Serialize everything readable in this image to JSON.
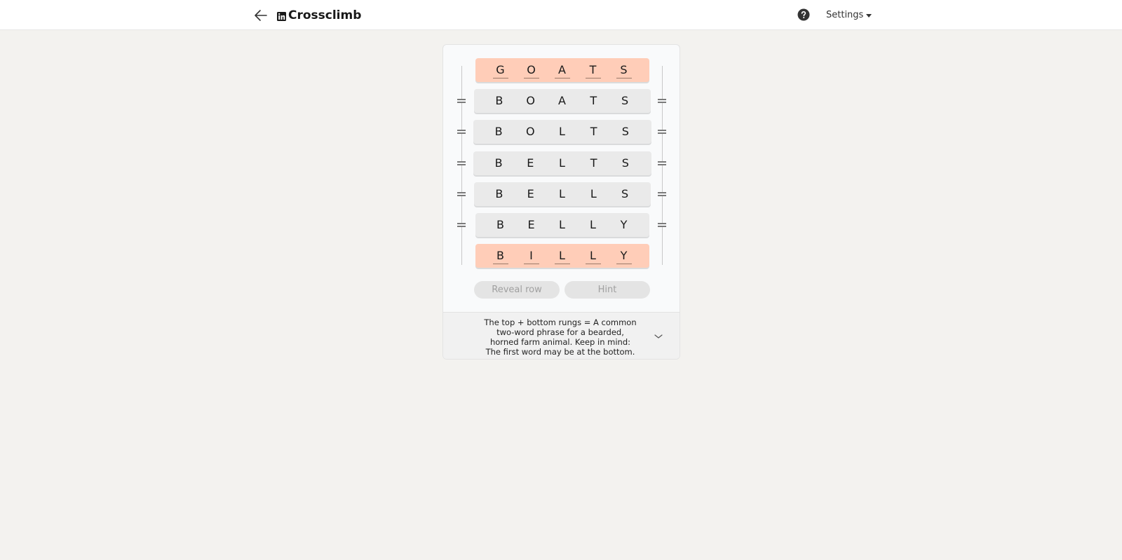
{
  "header": {
    "title": "Crossclimb",
    "settings_label": "Settings",
    "icons": {
      "back": "arrow-left-icon",
      "logo": "linkedin-logo-icon",
      "help": "question-circle-icon",
      "settings_caret": "caret-down-icon"
    }
  },
  "puzzle": {
    "rungs": [
      {
        "word": [
          "G",
          "O",
          "A",
          "T",
          "S"
        ],
        "type": "end"
      },
      {
        "word": [
          "B",
          "O",
          "A",
          "T",
          "S"
        ],
        "type": "middle"
      },
      {
        "word": [
          "B",
          "O",
          "L",
          "T",
          "S"
        ],
        "type": "middle"
      },
      {
        "word": [
          "B",
          "E",
          "L",
          "T",
          "S"
        ],
        "type": "middle"
      },
      {
        "word": [
          "B",
          "E",
          "L",
          "L",
          "S"
        ],
        "type": "middle"
      },
      {
        "word": [
          "B",
          "E",
          "L",
          "L",
          "Y"
        ],
        "type": "middle"
      },
      {
        "word": [
          "B",
          "I",
          "L",
          "L",
          "Y"
        ],
        "type": "end"
      }
    ],
    "end_color": "#ffcdb8",
    "middle_color": "#eaeaea"
  },
  "actions": {
    "reveal_row_label": "Reveal row",
    "hint_label": "Hint"
  },
  "clue": {
    "text": "The top + bottom rungs = A common two-word phrase for a bearded, horned farm animal. Keep in mind: The first word may be at the bottom.",
    "expand_icon": "chevron-down-icon"
  }
}
